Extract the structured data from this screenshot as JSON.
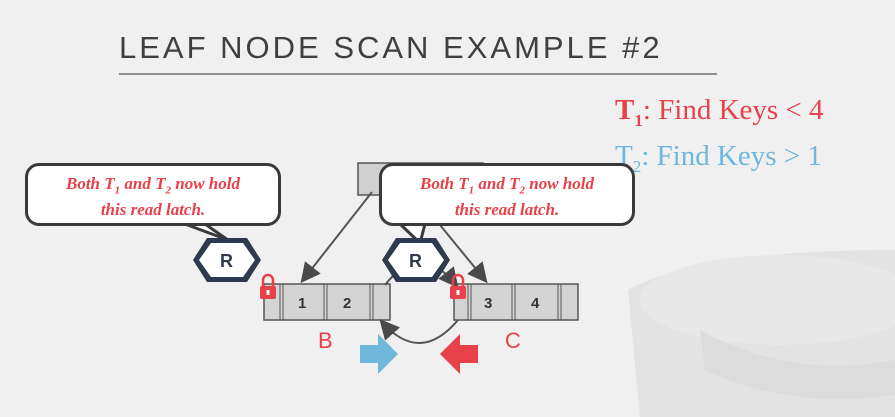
{
  "title": "LEAF NODE SCAN EXAMPLE #2",
  "tasks": {
    "t1": {
      "label": "T",
      "sub": "1",
      "text": ": Find Keys < 4",
      "color": "#e8414a"
    },
    "t2": {
      "label": "T",
      "sub": "2",
      "text": ": Find Keys > 1",
      "color": "#6fb7db"
    }
  },
  "callouts": [
    {
      "line1_a": "Both T",
      "sub1": "1",
      "line1_b": " and T",
      "sub2": "2",
      "line1_c": " now hold",
      "line2": "this read latch."
    },
    {
      "line1_a": "Both T",
      "sub1": "1",
      "line1_b": " and T",
      "sub2": "2",
      "line1_c": " now hold",
      "line2": "this read latch."
    }
  ],
  "latches": {
    "left": "R",
    "right": "R"
  },
  "nodes": {
    "B": {
      "label": "B",
      "keys": [
        "1",
        "2"
      ]
    },
    "C": {
      "label": "C",
      "keys": [
        "3",
        "4"
      ]
    }
  },
  "colors": {
    "accent_red": "#e8414a",
    "accent_blue": "#6fb7db",
    "latch_fill": "#2f3a4f"
  }
}
